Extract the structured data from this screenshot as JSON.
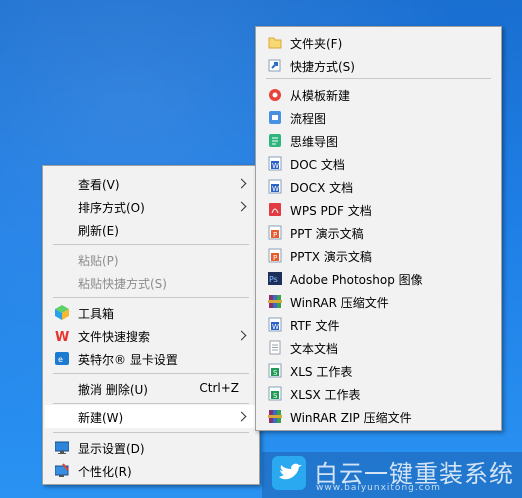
{
  "context_menu": {
    "items": [
      {
        "label": "查看(V)",
        "submenu": true
      },
      {
        "label": "排序方式(O)",
        "submenu": true
      },
      {
        "label": "刷新(E)"
      },
      {
        "label": "粘贴(P)",
        "disabled": true
      },
      {
        "label": "粘贴快捷方式(S)",
        "disabled": true
      },
      {
        "label": "工具箱",
        "icon": "toolbox-icon"
      },
      {
        "label": "文件快速搜索",
        "icon": "wps-icon",
        "submenu": true
      },
      {
        "label": "英特尔® 显卡设置",
        "icon": "intel-graphics-icon"
      },
      {
        "label": "撤消 删除(U)",
        "shortcut": "Ctrl+Z"
      },
      {
        "label": "新建(W)",
        "submenu": true,
        "highlighted": true
      },
      {
        "label": "显示设置(D)",
        "icon": "display-icon"
      },
      {
        "label": "个性化(R)",
        "icon": "personalize-icon"
      }
    ]
  },
  "new_submenu": {
    "items": [
      {
        "label": "文件夹(F)",
        "icon": "folder-icon",
        "color": "#f8d775"
      },
      {
        "label": "快捷方式(S)",
        "icon": "shortcut-icon",
        "color": "#2b6cc4"
      },
      {
        "label": "从模板新建",
        "icon": "template-icon",
        "color": "#e8433a"
      },
      {
        "label": "流程图",
        "icon": "flowchart-icon",
        "color": "#4a90e2"
      },
      {
        "label": "思维导图",
        "icon": "mindmap-icon",
        "color": "#2fb57e"
      },
      {
        "label": "DOC 文档",
        "icon": "word-doc-icon",
        "color": "#2b63c6"
      },
      {
        "label": "DOCX 文档",
        "icon": "word-docx-icon",
        "color": "#2b63c6"
      },
      {
        "label": "WPS PDF 文档",
        "icon": "pdf-icon",
        "color": "#e23b44"
      },
      {
        "label": "PPT 演示文稿",
        "icon": "ppt-icon",
        "color": "#e45b2c"
      },
      {
        "label": "PPTX 演示文稿",
        "icon": "pptx-icon",
        "color": "#e45b2c"
      },
      {
        "label": "Adobe Photoshop 图像",
        "icon": "photoshop-icon",
        "color": "#1e2f5a"
      },
      {
        "label": "WinRAR 压缩文件",
        "icon": "winrar-icon",
        "color": "#8a2f6e"
      },
      {
        "label": "RTF 文件",
        "icon": "rtf-icon",
        "color": "#2b63c6"
      },
      {
        "label": "文本文档",
        "icon": "text-doc-icon",
        "color": "#9aa3ad"
      },
      {
        "label": "XLS 工作表",
        "icon": "xls-icon",
        "color": "#1f9b57"
      },
      {
        "label": "XLSX 工作表",
        "icon": "xlsx-icon",
        "color": "#1f9b57"
      },
      {
        "label": "WinRAR ZIP 压缩文件",
        "icon": "winrar-zip-icon",
        "color": "#8a2f6e"
      }
    ]
  },
  "watermark": {
    "title": "白云一键重装系统",
    "url": "www.baiyunxitong.com"
  }
}
